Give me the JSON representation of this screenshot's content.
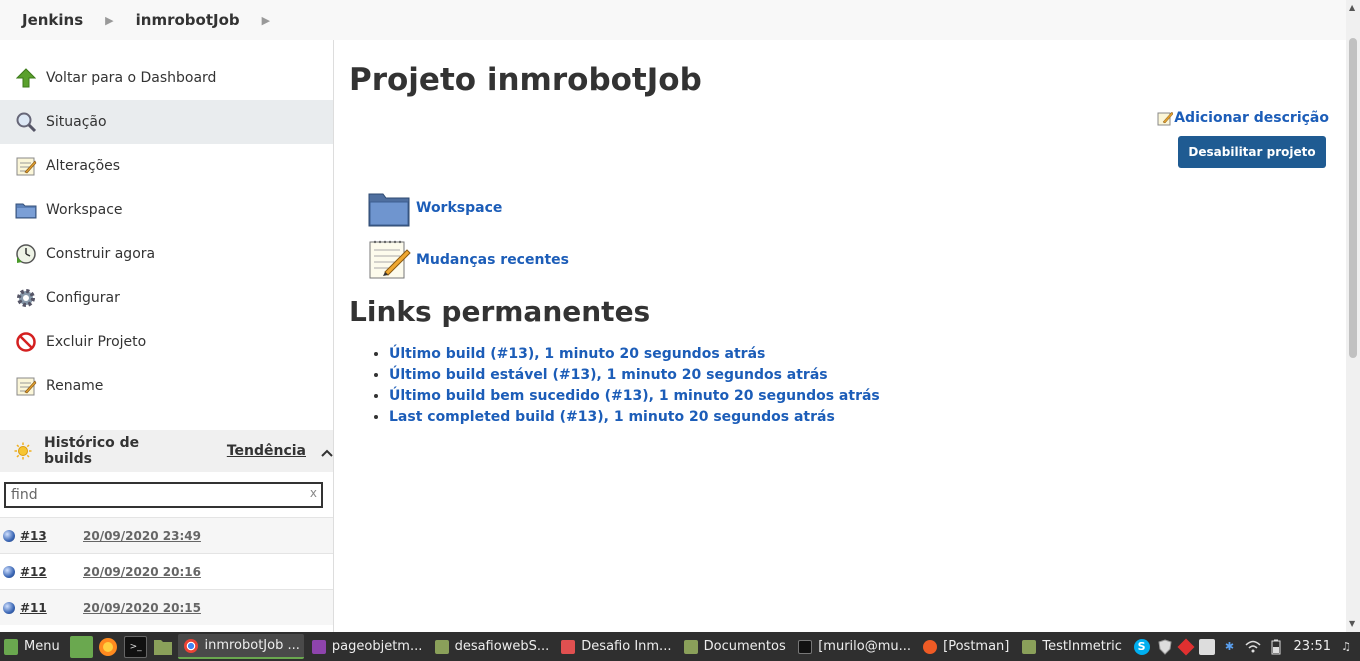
{
  "breadcrumb": {
    "home": "Jenkins",
    "job": "inmrobotJob"
  },
  "sidebar": {
    "tasks": [
      {
        "label": "Voltar para o Dashboard",
        "icon": "up-arrow-icon"
      },
      {
        "label": "Situação",
        "icon": "search-icon"
      },
      {
        "label": "Alterações",
        "icon": "notepad-icon"
      },
      {
        "label": "Workspace",
        "icon": "folder-icon"
      },
      {
        "label": "Construir agora",
        "icon": "clock-icon"
      },
      {
        "label": "Configurar",
        "icon": "gear-icon"
      },
      {
        "label": "Excluir Projeto",
        "icon": "no-entry-icon"
      },
      {
        "label": "Rename",
        "icon": "notepad-icon"
      }
    ],
    "build_history": {
      "title": "Histórico de builds",
      "trend": "Tendência",
      "find_placeholder": "find",
      "clear": "x",
      "builds": [
        {
          "number": "#13",
          "date": "20/09/2020 23:49"
        },
        {
          "number": "#12",
          "date": "20/09/2020 20:16"
        },
        {
          "number": "#11",
          "date": "20/09/2020 20:15"
        }
      ]
    }
  },
  "main": {
    "title": "Projeto inmrobotJob",
    "add_description": "Adicionar descrição",
    "disable_button": "Desabilitar projeto",
    "links": [
      {
        "label": "Workspace",
        "icon": "folder-icon"
      },
      {
        "label": "Mudanças recentes",
        "icon": "notepad-icon"
      }
    ],
    "permalinks_title": "Links permanentes",
    "permalinks": [
      "Último build (#13), 1 minuto 20 segundos atrás",
      "Último build estável (#13), 1 minuto 20 segundos atrás",
      "Último build bem sucedido (#13), 1 minuto 20 segundos atrás",
      "Last completed build (#13), 1 minuto 20 segundos atrás"
    ]
  },
  "taskbar": {
    "menu": "Menu",
    "windows": [
      {
        "label": "inmrobotJob ...",
        "active": true,
        "color": "#4285f4"
      },
      {
        "label": "pageobjetm...",
        "active": false,
        "color": "#8e44ad"
      },
      {
        "label": "desafiowebS...",
        "active": false,
        "color": "#8aa05a"
      },
      {
        "label": "Desafio Inm...",
        "active": false,
        "color": "#e05050"
      },
      {
        "label": "Documentos",
        "active": false,
        "color": "#8aa05a"
      },
      {
        "label": "[murilo@mu...",
        "active": false,
        "color": "#222222"
      },
      {
        "label": "[Postman]",
        "active": false,
        "color": "#ef5b25"
      },
      {
        "label": "TestInmetric",
        "active": false,
        "color": "#8aa05a"
      }
    ],
    "clock": "23:51"
  },
  "colors": {
    "link": "#1c5db8",
    "button": "#1f5b92",
    "taskbar": "#2f2f2f"
  }
}
